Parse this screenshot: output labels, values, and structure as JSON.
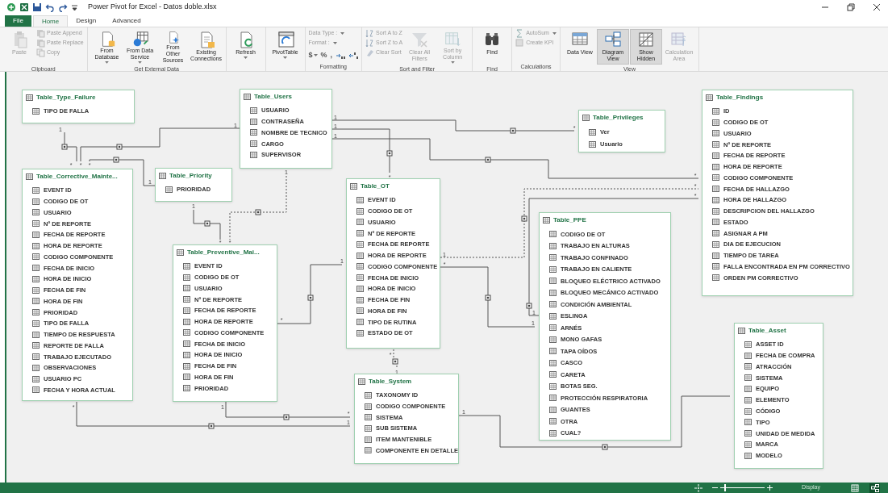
{
  "window": {
    "title": "Power Pivot for Excel - Datos doble.xlsx"
  },
  "tabs": [
    {
      "label": "File",
      "kind": "file",
      "selected": false
    },
    {
      "label": "Home",
      "kind": "tab",
      "selected": true
    },
    {
      "label": "Design",
      "kind": "tab",
      "selected": false
    },
    {
      "label": "Advanced",
      "kind": "tab",
      "selected": false
    }
  ],
  "ribbon_groups": [
    {
      "label": "Clipboard",
      "items": [
        {
          "label": "Paste",
          "kind": "large",
          "disabled": true
        },
        {
          "label": "Paste Append",
          "kind": "small",
          "disabled": true
        },
        {
          "label": "Paste Replace",
          "kind": "small",
          "disabled": true
        },
        {
          "label": "Copy",
          "kind": "small",
          "disabled": true
        }
      ]
    },
    {
      "label": "Get External Data",
      "items": [
        {
          "label": "From Database",
          "kind": "large",
          "disabled": false,
          "dropdown": true
        },
        {
          "label": "From Data Service",
          "kind": "large",
          "disabled": false,
          "dropdown": true
        },
        {
          "label": "From Other Sources",
          "kind": "large",
          "disabled": false
        },
        {
          "label": "Existing Connections",
          "kind": "large",
          "disabled": false
        }
      ]
    },
    {
      "items": [
        {
          "label": "Refresh",
          "kind": "large",
          "disabled": false,
          "dropdown": true
        }
      ]
    },
    {
      "items": [
        {
          "label": "PivotTable",
          "kind": "large",
          "disabled": false,
          "dropdown": true
        }
      ]
    },
    {
      "label": "Formatting",
      "items": [
        {
          "label": "Data Type :",
          "kind": "small",
          "disabled": true,
          "dropdown": true
        },
        {
          "label": "Format :",
          "kind": "small",
          "disabled": true,
          "dropdown": true
        },
        {
          "label": "$",
          "kind": "symbol",
          "disabled": true,
          "dropdown": true
        },
        {
          "label": "%",
          "kind": "symbol",
          "disabled": true
        },
        {
          "label": ",",
          "kind": "symbol",
          "disabled": true
        }
      ]
    },
    {
      "label": "Sort and Filter",
      "items": [
        {
          "label": "Sort A to Z",
          "kind": "small",
          "disabled": true
        },
        {
          "label": "Sort Z to A",
          "kind": "small",
          "disabled": true
        },
        {
          "label": "Clear Sort",
          "kind": "small",
          "disabled": true
        },
        {
          "label": "Clear All Filters",
          "kind": "large",
          "disabled": true
        },
        {
          "label": "Sort by Column",
          "kind": "large",
          "disabled": true,
          "dropdown": true
        }
      ]
    },
    {
      "label": "Find",
      "items": [
        {
          "label": "Find",
          "kind": "large",
          "disabled": false
        }
      ]
    },
    {
      "label": "Calculations",
      "items": [
        {
          "label": "AutoSum",
          "kind": "small",
          "disabled": true,
          "dropdown": true
        },
        {
          "label": "Create KPI",
          "kind": "small",
          "disabled": true
        }
      ]
    },
    {
      "label": "View",
      "items": [
        {
          "label": "Data View",
          "kind": "large",
          "disabled": false,
          "selected": false
        },
        {
          "label": "Diagram View",
          "kind": "large",
          "disabled": false,
          "selected": true
        },
        {
          "label": "Show Hidden",
          "kind": "large",
          "disabled": false,
          "selected": true
        },
        {
          "label": "Calculation Area",
          "kind": "large",
          "disabled": true,
          "selected": false
        }
      ]
    }
  ],
  "tables": [
    {
      "name": "Table_Type_Failure",
      "fields": [
        "TIPO DE FALLA"
      ]
    },
    {
      "name": "Table_Users",
      "fields": [
        "USUARIO",
        "CONTRASEÑA",
        "NOMBRE DE TECNICO",
        "CARGO",
        "SUPERVISOR"
      ]
    },
    {
      "name": "Table_Privileges",
      "fields": [
        "Ver",
        "Usuario"
      ]
    },
    {
      "name": "Table_Findings",
      "fields": [
        "ID",
        "CODIGO DE OT",
        "USUARIO",
        "Nº DE REPORTE",
        "FECHA DE REPORTE",
        "HORA DE REPORTE",
        "CODIGO COMPONENTE",
        "FECHA DE HALLAZGO",
        "HORA DE HALLAZGO",
        "DESCRIPCION DEL HALLAZGO",
        "ESTADO",
        "ASIGNAR A PM",
        "DIA DE EJECUCION",
        "TIEMPO DE TAREA",
        "FALLA ENCONTRADA EN PM CORRECTIVO",
        "ORDEN PM CORRECTIVO"
      ]
    },
    {
      "name": "Table_Corrective_Mainte...",
      "fields": [
        "EVENT ID",
        "CODIGO DE OT",
        "USUARIO",
        "Nº DE REPORTE",
        "FECHA DE REPORTE",
        "HORA DE REPORTE",
        "CODIGO COMPONENTE",
        "FECHA DE INICIO",
        "HORA DE INICIO",
        "FECHA DE FIN",
        "HORA DE FIN",
        "PRIORIDAD",
        "TIPO DE FALLA",
        "TIEMPO DE RESPUESTA",
        "REPORTE DE FALLA",
        "TRABAJO EJECUTADO",
        "OBSERVACIONES",
        "USUARIO PC",
        "FECHA Y HORA ACTUAL"
      ]
    },
    {
      "name": "Table_Priority",
      "fields": [
        "PRIORIDAD"
      ]
    },
    {
      "name": "Table_OT",
      "fields": [
        "EVENT ID",
        "CODIGO DE OT",
        "USUARIO",
        "Nº DE REPORTE",
        "FECHA DE REPORTE",
        "HORA DE REPORTE",
        "CODIGO COMPONENTE",
        "FECHA DE INICIO",
        "HORA DE INICIO",
        "FECHA DE FIN",
        "HORA DE FIN",
        "TIPO DE RUTINA",
        "ESTADO DE OT"
      ]
    },
    {
      "name": "Table_PPE",
      "fields": [
        "CODIGO DE OT",
        "TRABAJO EN ALTURAS",
        "TRABAJO CONFINADO",
        "TRABAJO EN CALIENTE",
        "BLOQUEO ELÉCTRICO ACTIVADO",
        "BLOQUEO MECÁNICO ACTIVADO",
        "CONDICIÓN AMBIENTAL",
        "ESLINGA",
        "ARNÉS",
        "MONO GAFAS",
        "TAPA OÍDOS",
        "CASCO",
        "CARETA",
        "BOTAS SEG.",
        "PROTECCIÓN RESPIRATORIA",
        "GUANTES",
        "OTRA",
        "CUAL?"
      ]
    },
    {
      "name": "Table_Preventive_Mai...",
      "fields": [
        "EVENT ID",
        "CODIGO DE OT",
        "USUARIO",
        "Nº DE REPORTE",
        "FECHA DE REPORTE",
        "HORA DE REPORTE",
        "CODIGO COMPONENTE",
        "FECHA DE INICIO",
        "HORA DE INICIO",
        "FECHA DE FIN",
        "HORA DE FIN",
        "PRIORIDAD"
      ]
    },
    {
      "name": "Table_System",
      "fields": [
        "TAXONOMY ID",
        "CODIGO COMPONENTE",
        "SISTEMA",
        "SUB SISTEMA",
        "ITEM MANTENIBLE",
        "COMPONENTE EN DETALLE"
      ]
    },
    {
      "name": "Table_Asset",
      "fields": [
        "ASSET ID",
        "FECHA DE COMPRA",
        "ATRACCIÓN",
        "SISTEMA",
        "EQUIPO",
        "ELEMENTO",
        "CÓDIGO",
        "TIPO",
        "UNIDAD DE MEDIDA",
        "MARCA",
        "MODELO"
      ]
    }
  ],
  "relationships": [
    {
      "from": "1",
      "to": "*",
      "active": true
    },
    {
      "from": "1",
      "to": "*",
      "active": true
    },
    {
      "from": "1",
      "to": "*",
      "active": true
    },
    {
      "from": "1",
      "to": "*",
      "active": true
    },
    {
      "from": "1",
      "to": "*",
      "active": false
    },
    {
      "from": "1",
      "to": "*",
      "active": true
    },
    {
      "from": "1",
      "to": "*",
      "active": true
    },
    {
      "from": "1",
      "to": "*",
      "active": true
    },
    {
      "from": "1",
      "to": "*",
      "active": false
    },
    {
      "from": "*",
      "to": "1",
      "active": true
    },
    {
      "from": "1",
      "to": "*",
      "active": true
    },
    {
      "from": "*",
      "to": "1",
      "active": true
    },
    {
      "from": "*",
      "to": "1",
      "active": false
    },
    {
      "from": "*",
      "to": "1",
      "active": true
    },
    {
      "from": "1",
      "to": "*",
      "active": true
    },
    {
      "from": "1",
      "active": true
    }
  ],
  "status_bar": {
    "zoom": {
      "level": 0.1
    },
    "display_label": "Display",
    "views": [
      {
        "selected": false
      },
      {
        "selected": true
      }
    ]
  }
}
